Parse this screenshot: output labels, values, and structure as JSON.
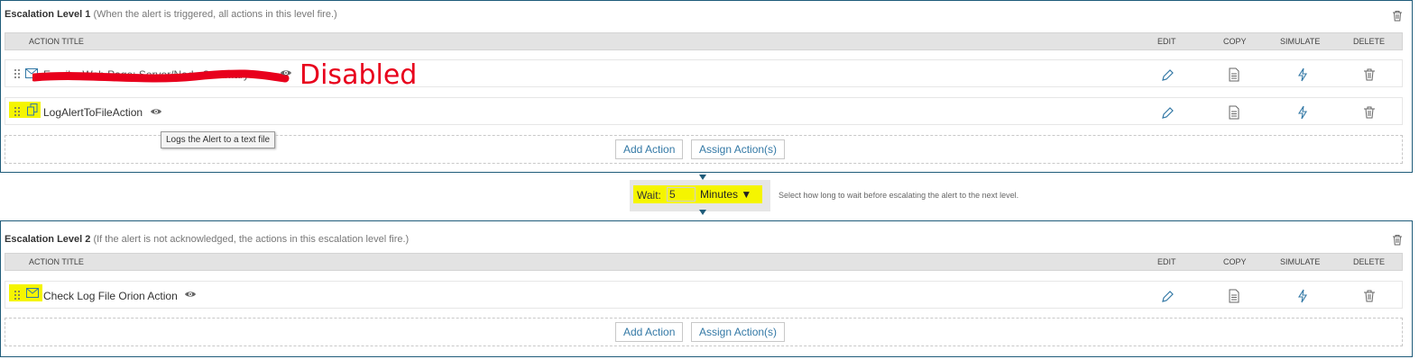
{
  "levels": [
    {
      "title": "Escalation Level 1",
      "description": "(When the alert is triggered, all actions in this level fire.)",
      "columns": {
        "title": "ACTION TITLE",
        "edit": "EDIT",
        "copy": "COPY",
        "simulate": "SIMULATE",
        "delete": "DELETE"
      },
      "actions": [
        {
          "title": "Email a Web Page: Server/Node Summary",
          "icon": "envelope-icon",
          "note": "Disabled"
        },
        {
          "title": "LogAlertToFileAction",
          "icon": "log-file-icon"
        }
      ],
      "add_action": "Add Action",
      "assign_action": "Assign Action(s)"
    },
    {
      "title": "Escalation Level 2",
      "description": "(If the alert is not acknowledged, the actions in this escalation level fire.)",
      "columns": {
        "title": "ACTION TITLE",
        "edit": "EDIT",
        "copy": "COPY",
        "simulate": "SIMULATE",
        "delete": "DELETE"
      },
      "actions": [
        {
          "title": "Check Log File Orion Action",
          "icon": "envelope-icon"
        }
      ],
      "add_action": "Add Action",
      "assign_action": "Assign Action(s)"
    }
  ],
  "tooltip": "Logs the Alert to a text file",
  "wait": {
    "label": "Wait:",
    "value": "5",
    "unit": "Minutes ▼",
    "help": "Select how long to wait before escalating the alert to the next level."
  },
  "colors": {
    "accent": "#1f5c7a",
    "link": "#3479a6",
    "highlight": "#f5f500",
    "annotation": "#e8001c"
  }
}
